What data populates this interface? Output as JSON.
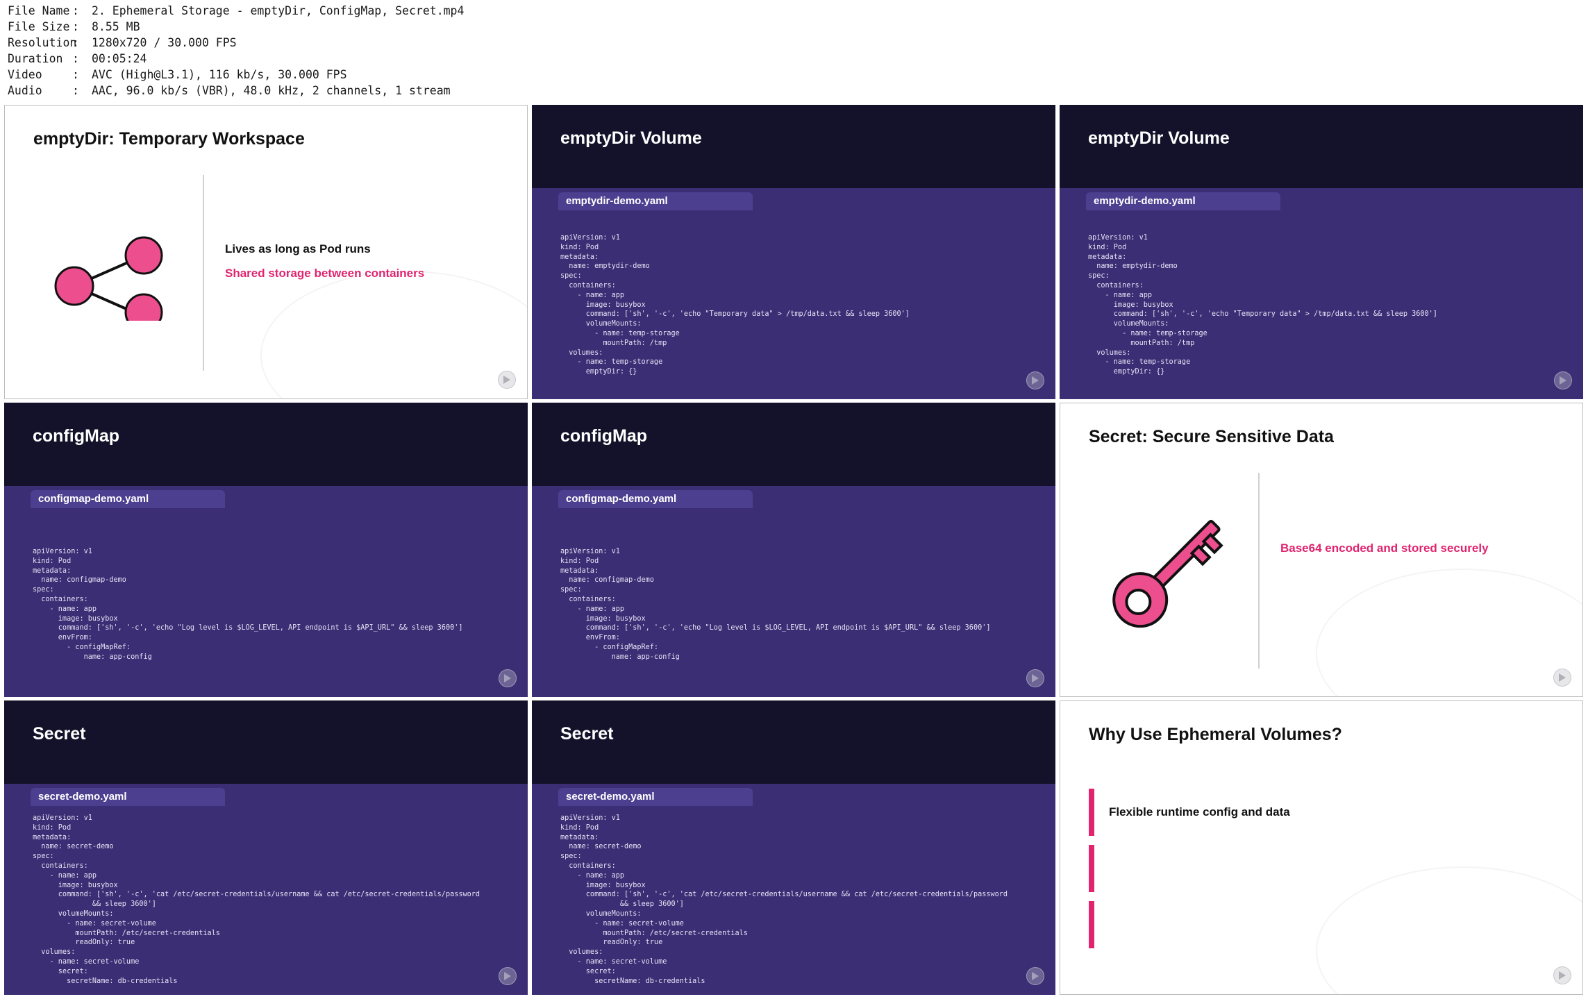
{
  "info": {
    "rows": [
      {
        "key": "File Name",
        "value": "2. Ephemeral Storage - emptyDir, ConfigMap, Secret.mp4"
      },
      {
        "key": "File Size",
        "value": "8.55 MB"
      },
      {
        "key": "Resolution",
        "value": "1280x720 / 30.000 FPS"
      },
      {
        "key": "Duration",
        "value": "00:05:24"
      },
      {
        "key": "Video",
        "value": "AVC (High@L3.1), 116 kb/s, 30.000 FPS"
      },
      {
        "key": "Audio",
        "value": "AAC, 96.0 kb/s (VBR), 48.0 kHz, 2 channels, 1 stream"
      }
    ],
    "separator": ":"
  },
  "colors": {
    "accent": "#e0246f",
    "slide_dark": "#3b2e74",
    "slide_header": "#14122a"
  },
  "thumbs": [
    {
      "title": "emptyDir: Temporary Workspace",
      "icon": "share-nodes-icon",
      "line1": "Lives as long as Pod runs",
      "line2": "Shared storage between containers"
    },
    {
      "title": "emptyDir Volume",
      "file": "emptydir-demo.yaml",
      "code": "apiVersion: v1\nkind: Pod\nmetadata:\n  name: emptydir-demo\nspec:\n  containers:\n    - name: app\n      image: busybox\n      command: ['sh', '-c', 'echo \"Temporary data\" > /tmp/data.txt && sleep 3600']\n      volumeMounts:\n        - name: temp-storage\n          mountPath: /tmp\n  volumes:\n    - name: temp-storage\n      emptyDir: {}"
    },
    {
      "title": "emptyDir Volume",
      "file": "emptydir-demo.yaml",
      "code": "apiVersion: v1\nkind: Pod\nmetadata:\n  name: emptydir-demo\nspec:\n  containers:\n    - name: app\n      image: busybox\n      command: ['sh', '-c', 'echo \"Temporary data\" > /tmp/data.txt && sleep 3600']\n      volumeMounts:\n        - name: temp-storage\n          mountPath: /tmp\n  volumes:\n    - name: temp-storage\n      emptyDir: {}"
    },
    {
      "title": "configMap",
      "file": "configmap-demo.yaml",
      "code": "apiVersion: v1\nkind: Pod\nmetadata:\n  name: configmap-demo\nspec:\n  containers:\n    - name: app\n      image: busybox\n      command: ['sh', '-c', 'echo \"Log level is $LOG_LEVEL, API endpoint is $API_URL\" && sleep 3600']\n      envFrom:\n        - configMapRef:\n            name: app-config"
    },
    {
      "title": "configMap",
      "file": "configmap-demo.yaml",
      "code": "apiVersion: v1\nkind: Pod\nmetadata:\n  name: configmap-demo\nspec:\n  containers:\n    - name: app\n      image: busybox\n      command: ['sh', '-c', 'echo \"Log level is $LOG_LEVEL, API endpoint is $API_URL\" && sleep 3600']\n      envFrom:\n        - configMapRef:\n            name: app-config"
    },
    {
      "title": "Secret: Secure Sensitive Data",
      "icon": "key-icon",
      "line1": "Base64 encoded and stored securely"
    },
    {
      "title": "Secret",
      "file": "secret-demo.yaml",
      "code": "apiVersion: v1\nkind: Pod\nmetadata:\n  name: secret-demo\nspec:\n  containers:\n    - name: app\n      image: busybox\n      command: ['sh', '-c', 'cat /etc/secret-credentials/username && cat /etc/secret-credentials/password\n              && sleep 3600']\n      volumeMounts:\n        - name: secret-volume\n          mountPath: /etc/secret-credentials\n          readOnly: true\n  volumes:\n    - name: secret-volume\n      secret:\n        secretName: db-credentials"
    },
    {
      "title": "Secret",
      "file": "secret-demo.yaml",
      "code": "apiVersion: v1\nkind: Pod\nmetadata:\n  name: secret-demo\nspec:\n  containers:\n    - name: app\n      image: busybox\n      command: ['sh', '-c', 'cat /etc/secret-credentials/username && cat /etc/secret-credentials/password\n              && sleep 3600']\n      volumeMounts:\n        - name: secret-volume\n          mountPath: /etc/secret-credentials\n          readOnly: true\n  volumes:\n    - name: secret-volume\n      secret:\n        secretName: db-credentials"
    },
    {
      "title": "Why Use Ephemeral Volumes?",
      "line1": "Flexible runtime config and data"
    }
  ]
}
